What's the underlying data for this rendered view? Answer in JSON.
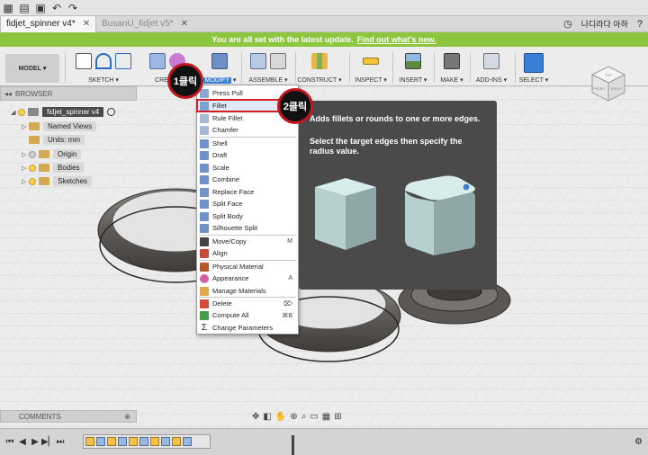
{
  "titlebar": {
    "tabs": [
      {
        "label": "fidjet_spinner v4*",
        "active": true
      },
      {
        "label": "BusanU_fidjet v5*",
        "active": false
      }
    ],
    "user": "나디라다 아하"
  },
  "banner": {
    "text": "You are all set with the latest update.",
    "link": "Find out what's new."
  },
  "toolbar": {
    "workspace": "MODEL",
    "groups": [
      "SKETCH",
      "CREATE",
      "MODIFY",
      "ASSEMBLE",
      "CONSTRUCT",
      "INSPECT",
      "INSERT",
      "MAKE",
      "ADD-INS",
      "SELECT"
    ],
    "dropdown_glyph": "▾"
  },
  "viewcube": {
    "top": "TOP",
    "front": "FRONT",
    "right": "RIGHT"
  },
  "browser": {
    "title": "BROWSER",
    "root": "fidjet_spinner v4",
    "items": [
      "Named Views",
      "Units: mm",
      "Origin",
      "Bodies",
      "Sketches"
    ]
  },
  "comments": {
    "title": "COMMENTS"
  },
  "menu": {
    "items": [
      {
        "label": "Press Pull",
        "shortcut": "Q"
      },
      {
        "label": "Fillet",
        "shortcut": "F"
      },
      {
        "label": "Rule Fillet",
        "shortcut": ""
      },
      {
        "label": "Chamfer",
        "shortcut": ""
      },
      {
        "label": "Shell",
        "shortcut": ""
      },
      {
        "label": "Draft",
        "shortcut": ""
      },
      {
        "label": "Scale",
        "shortcut": ""
      },
      {
        "label": "Combine",
        "shortcut": ""
      },
      {
        "label": "Replace Face",
        "shortcut": ""
      },
      {
        "label": "Split Face",
        "shortcut": ""
      },
      {
        "label": "Split Body",
        "shortcut": ""
      },
      {
        "label": "Silhouette Split",
        "shortcut": ""
      },
      {
        "label": "Move/Copy",
        "shortcut": "M"
      },
      {
        "label": "Align",
        "shortcut": ""
      },
      {
        "label": "Physical Material",
        "shortcut": ""
      },
      {
        "label": "Appearance",
        "shortcut": "A"
      },
      {
        "label": "Manage Materials",
        "shortcut": ""
      },
      {
        "label": "Delete",
        "shortcut": "⌦"
      },
      {
        "label": "Compute All",
        "shortcut": "⌘B"
      },
      {
        "label": "Change Parameters",
        "shortcut": ""
      }
    ]
  },
  "tooltip": {
    "title": "Adds fillets or rounds to one or more edges.",
    "body": "Select the target edges then specify the radius value."
  },
  "annotations": {
    "step1": "1클릭",
    "step2": "2클릭"
  },
  "colors": {
    "accent": "#3a7fd6",
    "banner": "#8cc63f",
    "highlight": "#d21f26"
  }
}
